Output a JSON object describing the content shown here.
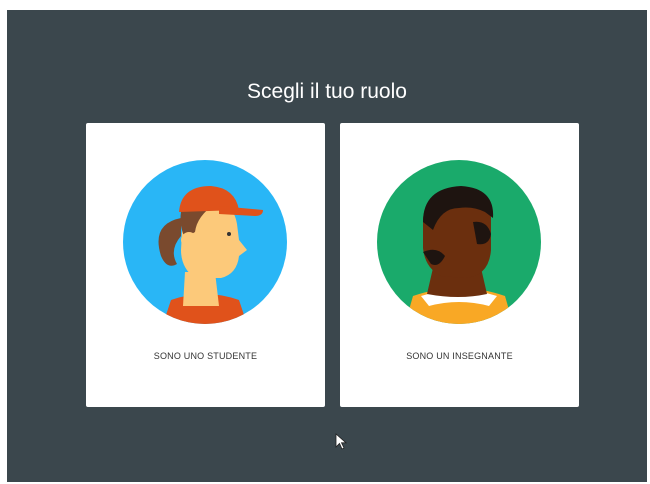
{
  "title": "Scegli il tuo ruolo",
  "roles": [
    {
      "label": "SONO UNO STUDENTE",
      "icon": "student-avatar",
      "accent": "#29b6f6"
    },
    {
      "label": "SONO UN INSEGNANTE",
      "icon": "teacher-avatar",
      "accent": "#1aaa6b"
    }
  ],
  "colors": {
    "background": "#3b474d",
    "card": "#ffffff",
    "student_cap": "#e0521b",
    "student_skin": "#fcc97a",
    "teacher_skin": "#6b2f0e",
    "teacher_shirt": "#f9a825"
  }
}
